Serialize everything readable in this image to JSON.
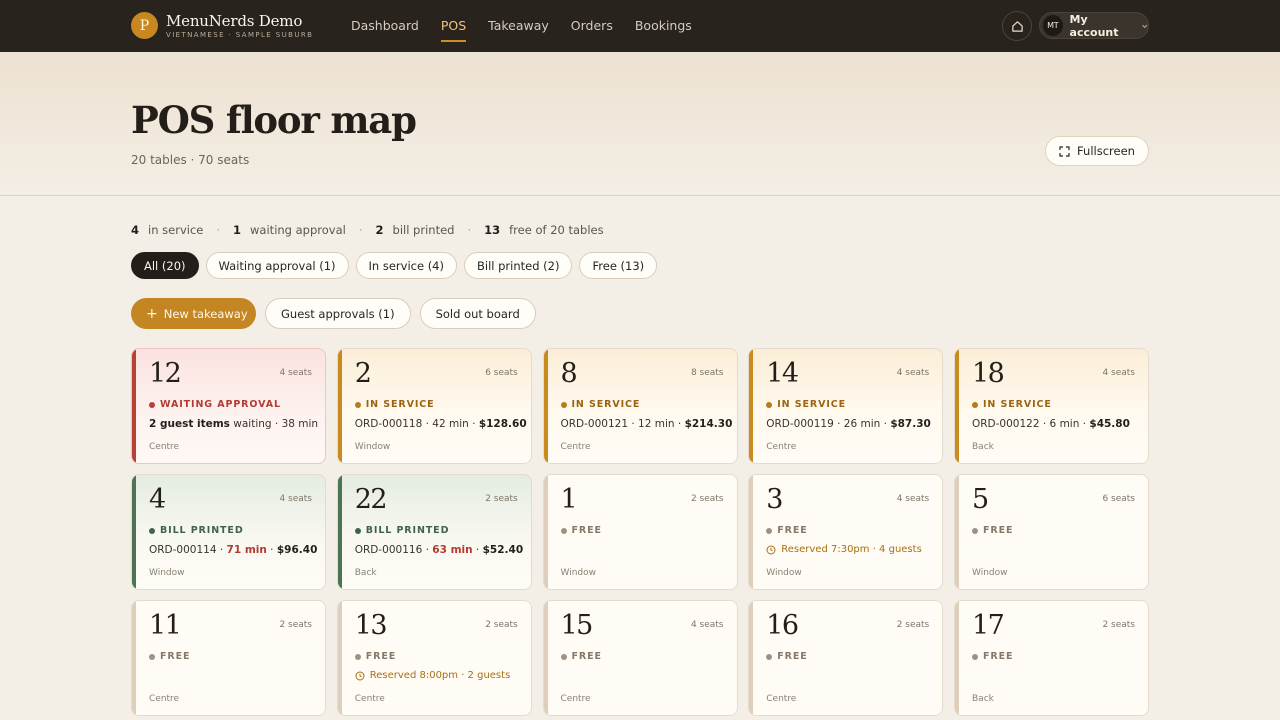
{
  "brand": {
    "logo_letter": "P",
    "name": "MenuNerds Demo",
    "subtitle": "VIETNAMESE · SAMPLE SUBURB"
  },
  "nav": [
    "Dashboard",
    "POS",
    "Takeaway",
    "Orders",
    "Bookings"
  ],
  "nav_active": "POS",
  "account": {
    "initials": "MT",
    "label": "My account"
  },
  "page": {
    "title": "POS floor map",
    "subtitle": "20 tables · 70 seats",
    "fullscreen_label": "Fullscreen"
  },
  "summary": {
    "in_service_count": "4",
    "in_service_label": "in service",
    "waiting_count": "1",
    "waiting_label": "waiting approval",
    "bill_count": "2",
    "bill_label": "bill printed",
    "free_count": "13",
    "free_label": "free of 20 tables"
  },
  "filters": [
    "All (20)",
    "Waiting approval (1)",
    "In service (4)",
    "Bill printed (2)",
    "Free (13)"
  ],
  "active_filter": "All (20)",
  "actions": {
    "new_takeaway": "New takeaway",
    "guest_approvals": "Guest approvals (1)",
    "sold_out_board": "Sold out board"
  },
  "tables": [
    {
      "number": "12",
      "seats": "4 seats",
      "state": "waiting",
      "status": "WAITING APPROVAL",
      "items": "2 guest items",
      "rest": " waiting · 38 min",
      "zone": "Centre"
    },
    {
      "number": "2",
      "seats": "6 seats",
      "state": "service",
      "status": "IN SERVICE",
      "order": "ORD-000118",
      "time": "42 min",
      "total": "$128.60",
      "zone": "Window"
    },
    {
      "number": "8",
      "seats": "8 seats",
      "state": "service",
      "status": "IN SERVICE",
      "order": "ORD-000121",
      "time": "12 min",
      "total": "$214.30",
      "zone": "Centre"
    },
    {
      "number": "14",
      "seats": "4 seats",
      "state": "service",
      "status": "IN SERVICE",
      "order": "ORD-000119",
      "time": "26 min",
      "total": "$87.30",
      "zone": "Centre"
    },
    {
      "number": "18",
      "seats": "4 seats",
      "state": "service",
      "status": "IN SERVICE",
      "order": "ORD-000122",
      "time": "6 min",
      "total": "$45.80",
      "zone": "Back"
    },
    {
      "number": "4",
      "seats": "4 seats",
      "state": "bill",
      "status": "BILL PRINTED",
      "order": "ORD-000114",
      "time": "71 min",
      "total": "$96.40",
      "zone": "Window"
    },
    {
      "number": "22",
      "seats": "2 seats",
      "state": "bill",
      "status": "BILL PRINTED",
      "order": "ORD-000116",
      "time": "63 min",
      "total": "$52.40",
      "zone": "Back"
    },
    {
      "number": "1",
      "seats": "2 seats",
      "state": "free",
      "status": "FREE",
      "zone": "Window"
    },
    {
      "number": "3",
      "seats": "4 seats",
      "state": "free",
      "status": "FREE",
      "reserved": "Reserved 7:30pm · 4 guests",
      "zone": "Window"
    },
    {
      "number": "5",
      "seats": "6 seats",
      "state": "free",
      "status": "FREE",
      "zone": "Window"
    },
    {
      "number": "11",
      "seats": "2 seats",
      "state": "free",
      "status": "FREE",
      "zone": "Centre"
    },
    {
      "number": "13",
      "seats": "2 seats",
      "state": "free",
      "status": "FREE",
      "reserved": "Reserved 8:00pm · 2 guests",
      "zone": "Centre"
    },
    {
      "number": "15",
      "seats": "4 seats",
      "state": "free",
      "status": "FREE",
      "zone": "Centre"
    },
    {
      "number": "16",
      "seats": "2 seats",
      "state": "free",
      "status": "FREE",
      "zone": "Centre"
    },
    {
      "number": "17",
      "seats": "2 seats",
      "state": "free",
      "status": "FREE",
      "zone": "Back"
    }
  ],
  "colors": {
    "topbar": "#28231d",
    "accent": "#c48622",
    "waiting": "#b84136",
    "service": "#c98a1f",
    "bill": "#4c7356",
    "free": "#ddcfbb"
  },
  "icons": [
    "home-icon",
    "chevron-down-icon",
    "fullscreen-icon",
    "plus-icon",
    "clock-icon"
  ]
}
